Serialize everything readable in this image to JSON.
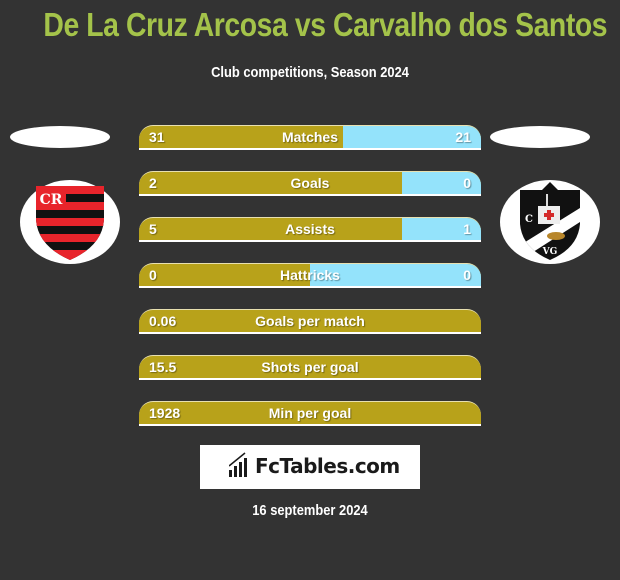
{
  "header": {
    "title": "De La Cruz Arcosa vs Carvalho dos Santos",
    "subtitle": "Club competitions, Season 2024"
  },
  "teams": {
    "left": {
      "crest_icon": "flamengo-crest-icon",
      "colors": [
        "#e8242b",
        "#111111"
      ]
    },
    "right": {
      "crest_icon": "vasco-crest-icon",
      "colors": [
        "#111111",
        "#ffffff",
        "#d42a2a"
      ]
    }
  },
  "colors": {
    "left_bar": "#b8a21a",
    "right_bar": "#94e3fb",
    "title": "#a4c34a",
    "background": "#333333"
  },
  "stats": [
    {
      "label": "Matches",
      "left": "31",
      "right": "21",
      "left_share": 0.596
    },
    {
      "label": "Goals",
      "left": "2",
      "right": "0",
      "left_share": 0.77
    },
    {
      "label": "Assists",
      "left": "5",
      "right": "1",
      "left_share": 0.77
    },
    {
      "label": "Hattricks",
      "left": "0",
      "right": "0",
      "left_share": 0.5
    },
    {
      "label": "Goals per match",
      "left": "0.06",
      "right": "",
      "left_share": 1.0
    },
    {
      "label": "Shots per goal",
      "left": "15.5",
      "right": "",
      "left_share": 1.0
    },
    {
      "label": "Min per goal",
      "left": "1928",
      "right": "",
      "left_share": 1.0
    }
  ],
  "brand": {
    "name": "FcTables.com",
    "icon": "bar-chart-icon"
  },
  "footer": {
    "date": "16 september 2024"
  }
}
